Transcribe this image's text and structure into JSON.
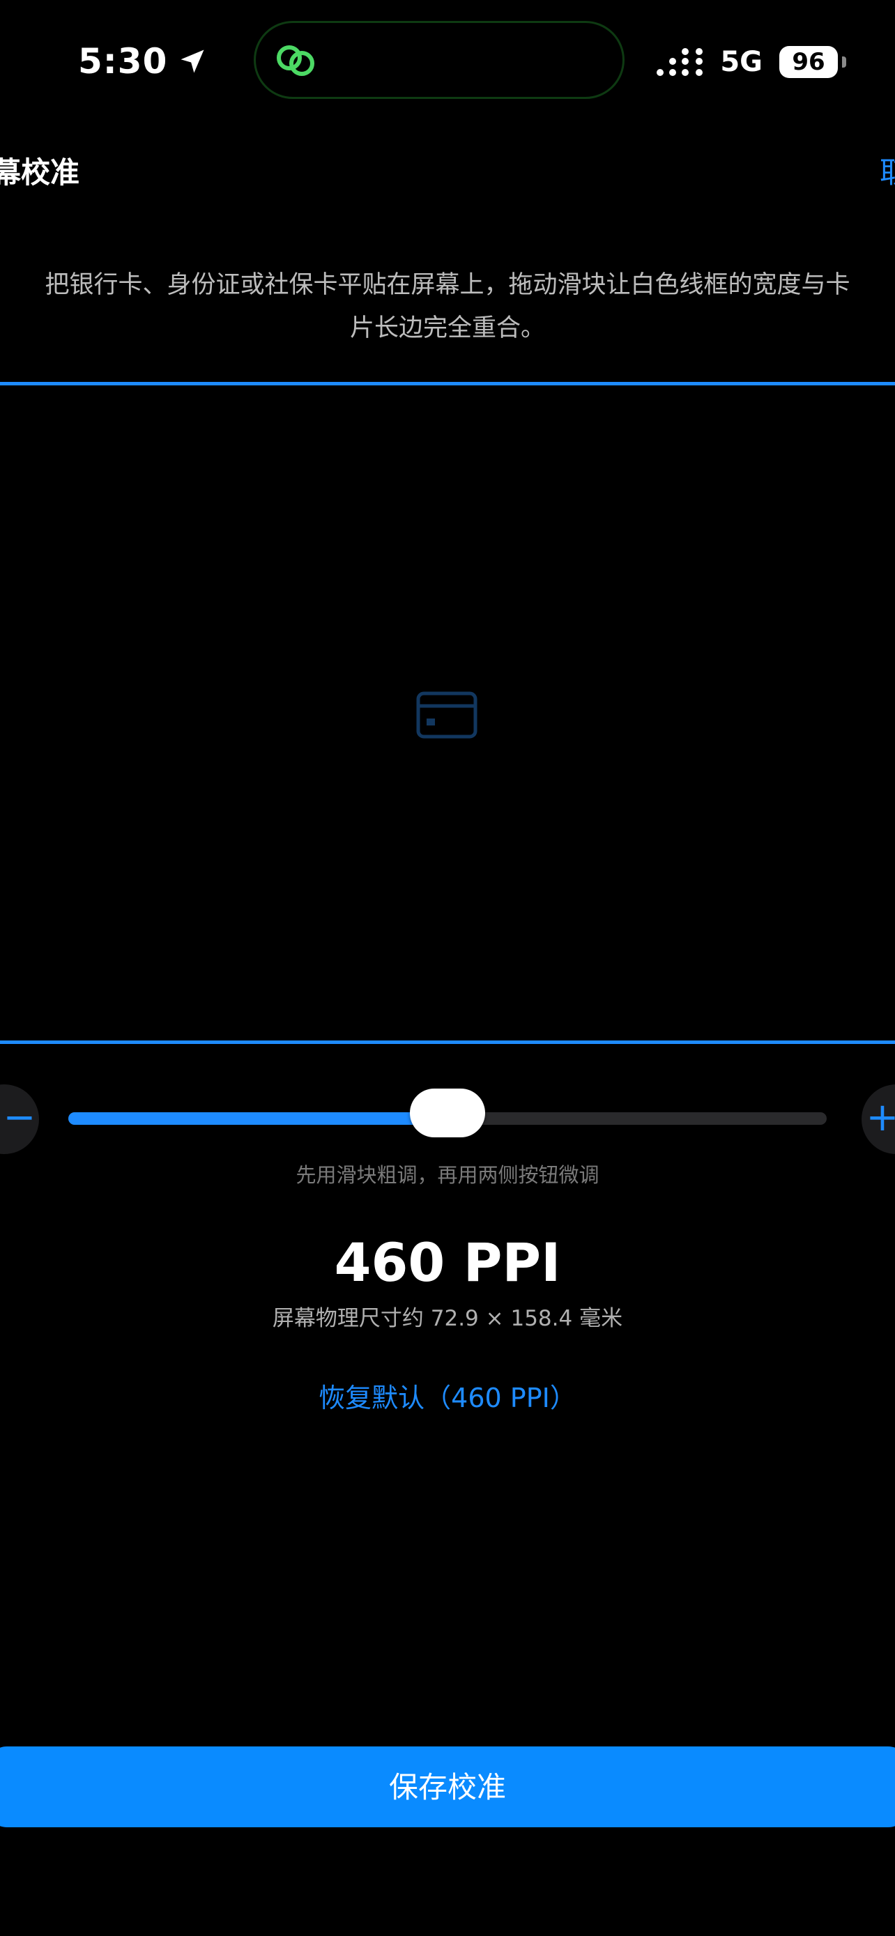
{
  "status_bar": {
    "time": "5:30",
    "network": "5G",
    "battery": "96"
  },
  "header": {
    "title": "幕校准",
    "cancel_label": "取"
  },
  "instruction": {
    "line1": "把银行卡、身份证或社保卡平贴在屏幕上，拖动滑块让白色线框的宽度与卡",
    "line2": "片长边完全重合。"
  },
  "slider": {
    "decrease_label": "−",
    "increase_label": "+",
    "value_fraction": 0.5,
    "hint": "先用滑块粗调，再用两侧按钮微调"
  },
  "readout": {
    "ppi": "460 PPI",
    "size": "屏幕物理尺寸约 72.9 × 158.4 毫米"
  },
  "reset_label": "恢复默认（460 PPI）",
  "save_label": "保存校准",
  "colors": {
    "accent": "#1e8bff",
    "save_button": "#0a8bff",
    "background": "#000000"
  },
  "icons": {
    "location": "location-arrow-icon",
    "island": "link-icon",
    "signal": "signal-icon",
    "card": "credit-card-icon"
  }
}
